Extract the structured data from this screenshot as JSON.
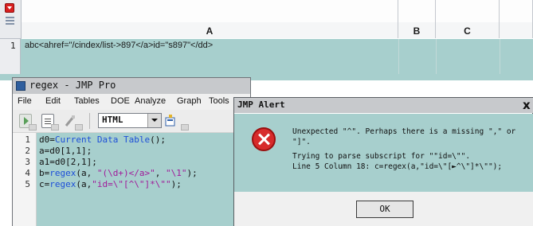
{
  "data_table": {
    "columns": [
      {
        "name": "A"
      },
      {
        "name": "B"
      },
      {
        "name": "C"
      }
    ],
    "rows": [
      {
        "number": "1",
        "cell_a": "abc<ahref=\"/cindex/list->897</a>id=\"s897\"</dd>"
      }
    ]
  },
  "script_window": {
    "title": "regex - JMP Pro",
    "menu": [
      "File",
      "Edit",
      "Tables",
      "DOE",
      "Analyze",
      "Graph",
      "Tools"
    ],
    "language_select": "HTML",
    "lines": [
      {
        "n": "1",
        "text": "d0=Current Data Table();"
      },
      {
        "n": "2",
        "text": "a=d0[1,1];"
      },
      {
        "n": "3",
        "text": "a1=d0[2,1];"
      },
      {
        "n": "4",
        "text": "b=regex(a, \"(\\d+)</a>\", \"\\1\");"
      },
      {
        "n": "5",
        "text": "c=regex(a,\"id=\\\"[^\\\"]*\\\"\");"
      }
    ]
  },
  "alert": {
    "title": "JMP Alert",
    "close_label": "x",
    "message_lines": [
      "Unexpected \"^\". Perhaps there is a missing \",\" or",
      "\"]\".",
      "Trying to parse subscript for \"\"id=\\\"\".",
      "Line 5 Column 18: c=regex(a,\"id=\\\"[►^\\\"]*\\\"\");"
    ],
    "ok_label": "OK"
  },
  "colors": {
    "selection_teal": "#a7cfcd",
    "error_red": "#d72b2b",
    "keyword_blue": "#1d4fd8",
    "string_magenta": "#a01a9a"
  }
}
